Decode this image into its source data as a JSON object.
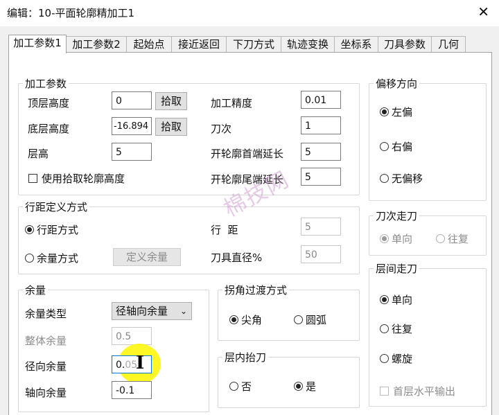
{
  "window": {
    "title": "编辑：10-平面轮廓精加工1",
    "close": "✕"
  },
  "tabs": [
    "加工参数1",
    "加工参数2",
    "起始点",
    "接近返回",
    "下刀方式",
    "轨迹变换",
    "坐标系",
    "刀具参数",
    "几何"
  ],
  "machining": {
    "legend": "加工参数",
    "top_height_label": "顶层高度",
    "top_height_value": "0",
    "pick1": "拾取",
    "bottom_height_label": "底层高度",
    "bottom_height_value": "-16.894",
    "pick2": "拾取",
    "layer_height_label": "层高",
    "layer_height_value": "5",
    "use_pick_contour_label": "使用拾取轮廓高度",
    "precision_label": "加工精度",
    "precision_value": "0.01",
    "pass_count_label": "刀次",
    "pass_count_value": "1",
    "open_start_ext_label": "开轮廓首端延长",
    "open_start_ext_value": "5",
    "open_end_ext_label": "开轮廓尾端延长",
    "open_end_ext_value": "5"
  },
  "stepover": {
    "legend": "行距定义方式",
    "mode_stepover": "行距方式",
    "mode_allowance": "余量方式",
    "define_allowance_btn": "定义余量",
    "stepover_label": "行  距",
    "stepover_value": "5",
    "tool_diameter_label": "刀具直径%",
    "tool_diameter_value": "50"
  },
  "allowance": {
    "legend": "余量",
    "type_label": "余量类型",
    "type_value": "径轴向余量",
    "overall_label": "整体余量",
    "overall_value": "0.5",
    "radial_label": "径向余量",
    "radial_value_a": "0.",
    "radial_value_b": "05",
    "axial_label": "轴向余量",
    "axial_value": "-0.1"
  },
  "corner": {
    "legend": "拐角过渡方式",
    "sharp": "尖角",
    "arc": "圆弧"
  },
  "lift": {
    "legend": "层内抬刀",
    "no": "否",
    "yes": "是"
  },
  "offset": {
    "legend": "偏移方向",
    "left": "左偏",
    "right": "右偏",
    "none": "无偏移"
  },
  "pass_mode": {
    "legend": "刀次走刀",
    "oneway": "单向",
    "zigzag": "往复"
  },
  "layer_mode": {
    "legend": "层间走刀",
    "oneway": "单向",
    "zigzag": "往复",
    "spiral": "螺旋",
    "first_layer_flat": "首层水平输出"
  },
  "watermark": "棉技网"
}
